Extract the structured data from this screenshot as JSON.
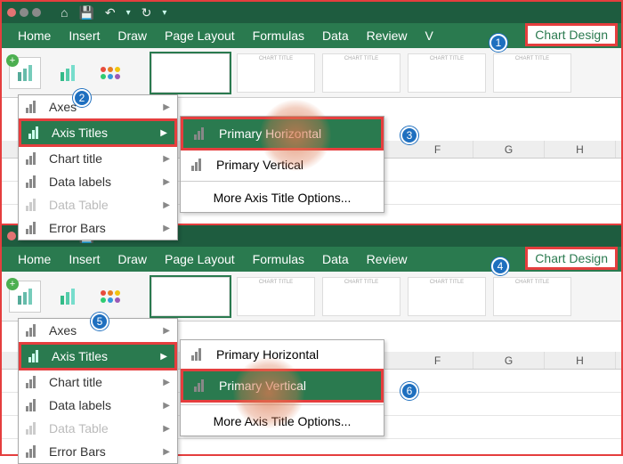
{
  "qat": {
    "home_icon": "⌂",
    "save_icon": "💾",
    "undo_icon": "↶",
    "redo_icon": "↻"
  },
  "tabs": [
    "Home",
    "Insert",
    "Draw",
    "Page Layout",
    "Formulas",
    "Data",
    "Review",
    "V"
  ],
  "active_tab": "Chart Design",
  "style_thumb_label": "CHART TITLE",
  "add_element_menu": {
    "items": [
      {
        "label": "Axes"
      },
      {
        "label": "Axis Titles",
        "highlight": true
      },
      {
        "label": "Chart title"
      },
      {
        "label": "Data labels"
      },
      {
        "label": "Data Table"
      },
      {
        "label": "Error Bars"
      }
    ]
  },
  "axis_titles_submenu": {
    "primary_h": "Primary Horizontal",
    "primary_v": "Primary Vertical",
    "more": "More Axis Title Options..."
  },
  "grid_cols": [
    "F",
    "G",
    "H"
  ],
  "steps": {
    "1": "1",
    "2": "2",
    "3": "3",
    "4": "4",
    "5": "5",
    "6": "6"
  }
}
